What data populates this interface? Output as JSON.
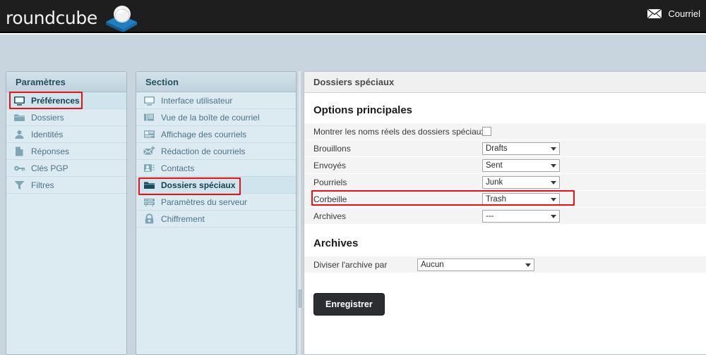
{
  "header": {
    "brand": "roundcube",
    "brand_icon": "roundcube-logo-icon",
    "mail_link_label": "Courriel",
    "mail_icon": "envelope-icon"
  },
  "settings_panel": {
    "title": "Paramètres",
    "items": [
      {
        "label": "Préférences",
        "icon": "monitor-icon",
        "active": true,
        "highlighted": true
      },
      {
        "label": "Dossiers",
        "icon": "folder-icon",
        "active": false,
        "highlighted": false
      },
      {
        "label": "Identités",
        "icon": "person-icon",
        "active": false,
        "highlighted": false
      },
      {
        "label": "Réponses",
        "icon": "document-icon",
        "active": false,
        "highlighted": false
      },
      {
        "label": "Clés PGP",
        "icon": "key-icon",
        "active": false,
        "highlighted": false
      },
      {
        "label": "Filtres",
        "icon": "funnel-icon",
        "active": false,
        "highlighted": false
      }
    ]
  },
  "section_panel": {
    "title": "Section",
    "items": [
      {
        "label": "Interface utilisateur",
        "icon": "monitor-icon",
        "active": false,
        "highlighted": false
      },
      {
        "label": "Vue de la boîte de courriel",
        "icon": "mailbox-view-icon",
        "active": false,
        "highlighted": false
      },
      {
        "label": "Affichage des courriels",
        "icon": "message-display-icon",
        "active": false,
        "highlighted": false
      },
      {
        "label": "Rédaction de courriels",
        "icon": "compose-envelope-icon",
        "active": false,
        "highlighted": false
      },
      {
        "label": "Contacts",
        "icon": "contact-card-icon",
        "active": false,
        "highlighted": false
      },
      {
        "label": "Dossiers spéciaux",
        "icon": "folder-icon",
        "active": true,
        "highlighted": true
      },
      {
        "label": "Paramètres du serveur",
        "icon": "server-icon",
        "active": false,
        "highlighted": false
      },
      {
        "label": "Chiffrement",
        "icon": "lock-icon",
        "active": false,
        "highlighted": false
      }
    ]
  },
  "main": {
    "title": "Dossiers spéciaux",
    "main_options": {
      "heading": "Options principales",
      "show_real_names": {
        "label": "Montrer les noms réels des dossiers spéciaux",
        "checked": false
      },
      "folders": [
        {
          "label": "Brouillons",
          "value": "Drafts",
          "highlighted": false
        },
        {
          "label": "Envoyés",
          "value": "Sent",
          "highlighted": false
        },
        {
          "label": "Pourriels",
          "value": "Junk",
          "highlighted": false
        },
        {
          "label": "Corbeille",
          "value": "Trash",
          "highlighted": true
        },
        {
          "label": "Archives",
          "value": "---",
          "highlighted": false
        }
      ]
    },
    "archives": {
      "heading": "Archives",
      "split_label": "Diviser l'archive par",
      "split_value": "Aucun"
    },
    "save_label": "Enregistrer"
  },
  "colors": {
    "topbar": "#1e1e1e",
    "page_bg": "#c9d5de",
    "panel_bg": "#dcebf2",
    "accent_blue": "#1f7aa8",
    "annotation_red": "#ee1111",
    "button_dark": "#2b2d31"
  }
}
